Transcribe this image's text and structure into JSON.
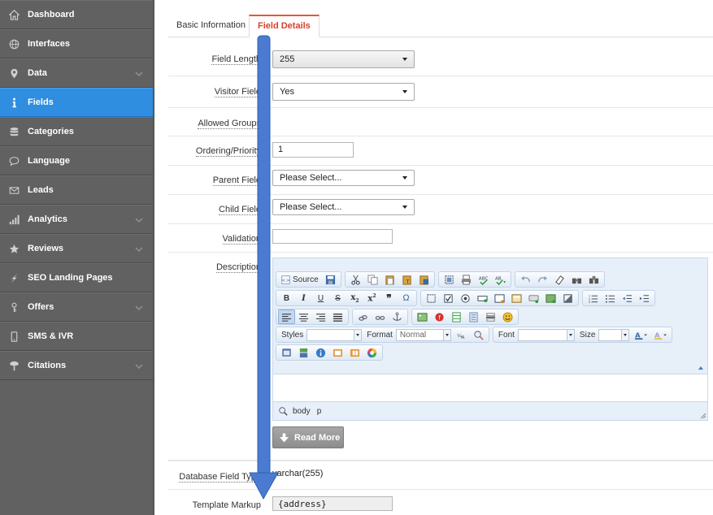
{
  "sidebar": {
    "items": [
      {
        "label": "Dashboard",
        "icon": "home-icon",
        "has_chevron": false,
        "active": false
      },
      {
        "label": "Interfaces",
        "icon": "globe-icon",
        "has_chevron": false,
        "active": false
      },
      {
        "label": "Data",
        "icon": "map-pin-icon",
        "has_chevron": true,
        "active": false
      },
      {
        "label": "Fields",
        "icon": "info-icon",
        "has_chevron": false,
        "active": true
      },
      {
        "label": "Categories",
        "icon": "database-icon",
        "has_chevron": false,
        "active": false
      },
      {
        "label": "Language",
        "icon": "speech-bubble-icon",
        "has_chevron": false,
        "active": false
      },
      {
        "label": "Leads",
        "icon": "envelope-icon",
        "has_chevron": false,
        "active": false
      },
      {
        "label": "Analytics",
        "icon": "bar-chart-icon",
        "has_chevron": true,
        "active": false
      },
      {
        "label": "Reviews",
        "icon": "star-icon",
        "has_chevron": true,
        "active": false
      },
      {
        "label": "SEO Landing Pages",
        "icon": "lightning-icon",
        "has_chevron": false,
        "active": false
      },
      {
        "label": "Offers",
        "icon": "tag-icon",
        "has_chevron": true,
        "active": false
      },
      {
        "label": "SMS & IVR",
        "icon": "phone-icon",
        "has_chevron": false,
        "active": false
      },
      {
        "label": "Citations",
        "icon": "signpost-icon",
        "has_chevron": true,
        "active": false
      }
    ]
  },
  "tabs": [
    {
      "label": "Basic Information",
      "active": false
    },
    {
      "label": "Field Details",
      "active": true
    }
  ],
  "form": {
    "field_length": {
      "label": "Field Length",
      "value": "255"
    },
    "visitor_field": {
      "label": "Visitor Field",
      "value": "Yes"
    },
    "allowed_groups": {
      "label": "Allowed Groups"
    },
    "ordering_priority": {
      "label": "Ordering/Priority",
      "value": "1"
    },
    "parent_field": {
      "label": "Parent Field",
      "value": "Please Select..."
    },
    "child_field": {
      "label": "Child Field",
      "value": "Please Select..."
    },
    "validation": {
      "label": "Validation",
      "value": ""
    },
    "description": {
      "label": "Description"
    },
    "database_field_type": {
      "label": "Database Field Type",
      "value": "varchar(255)"
    },
    "template_markup": {
      "label": "Template Markup",
      "value": "{address}"
    }
  },
  "editor": {
    "source_label": "Source",
    "styles_label": "Styles",
    "format_label": "Format",
    "format_value": "Normal",
    "font_label": "Font",
    "size_label": "Size",
    "path": [
      "body",
      "p"
    ]
  },
  "read_more_label": "Read More",
  "colors": {
    "sidebar_bg": "#616161",
    "active_nav": "#2f8ee0",
    "active_tab_accent": "#e8553c",
    "annotation_arrow": "#4a7bd0"
  }
}
